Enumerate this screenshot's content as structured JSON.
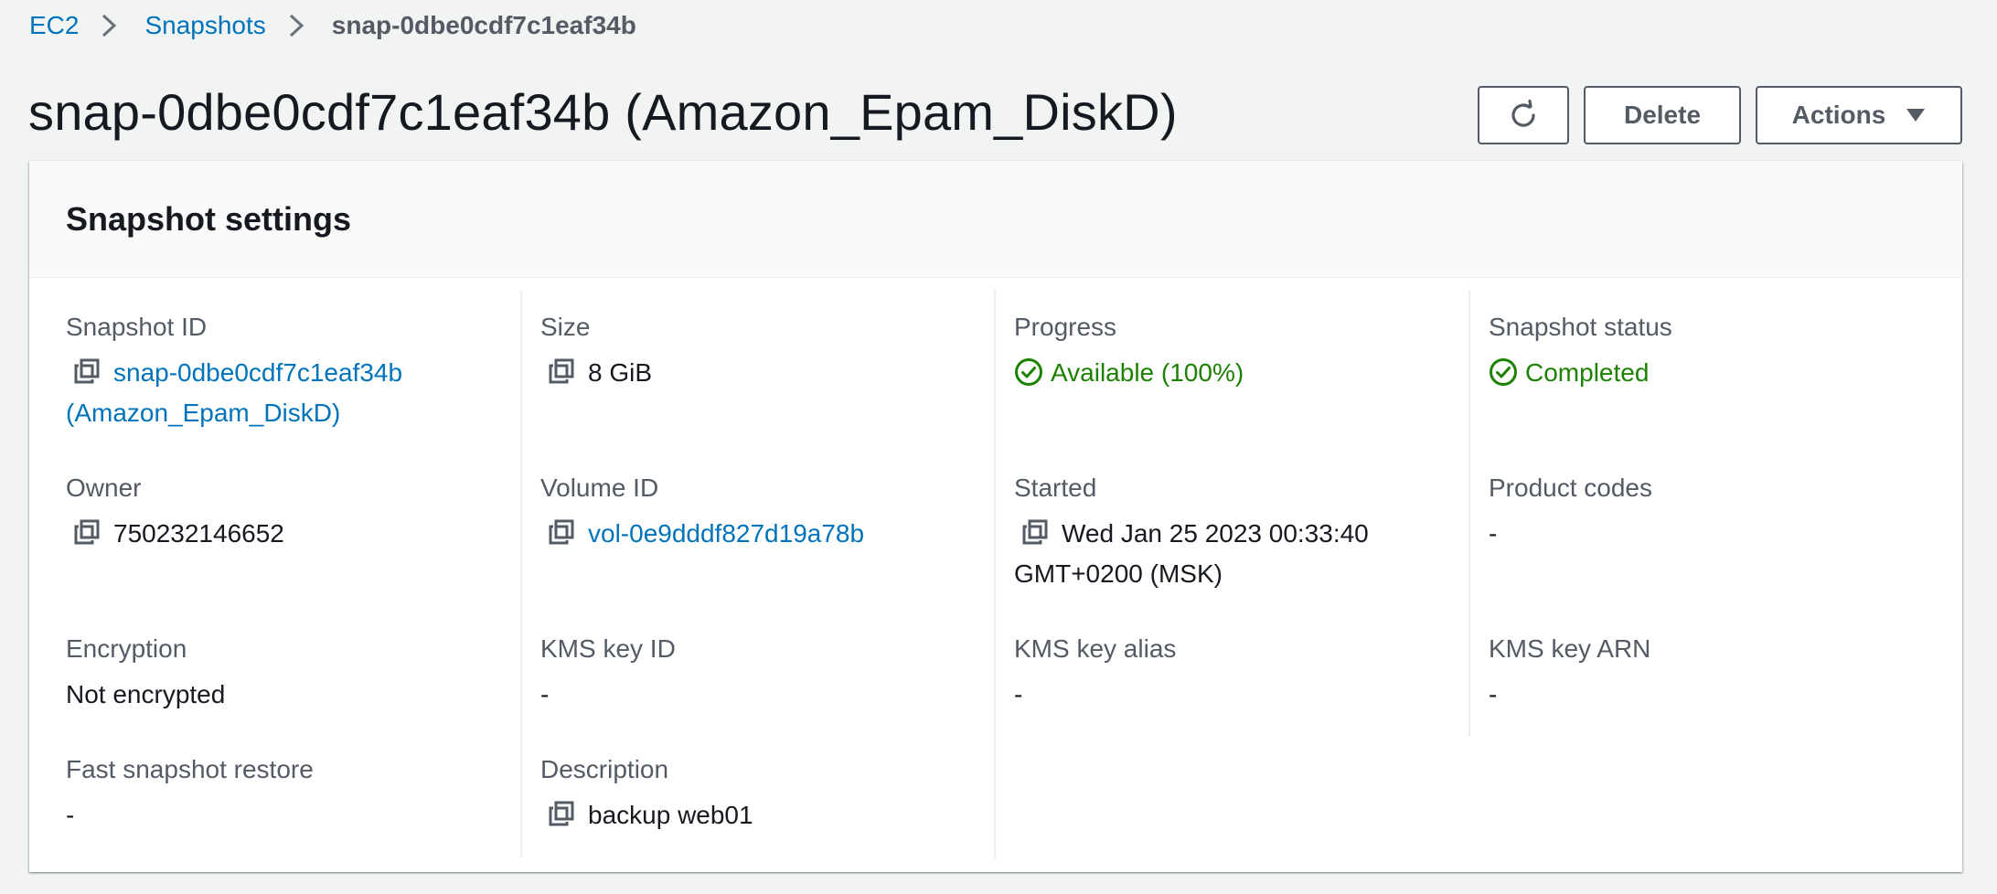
{
  "breadcrumb": {
    "ec2": "EC2",
    "snapshots": "Snapshots",
    "current": "snap-0dbe0cdf7c1eaf34b"
  },
  "page": {
    "title": "snap-0dbe0cdf7c1eaf34b (Amazon_Epam_DiskD)"
  },
  "toolbar": {
    "refresh_icon": "refresh-icon",
    "delete_label": "Delete",
    "actions_label": "Actions"
  },
  "panel": {
    "title": "Snapshot settings"
  },
  "fields": {
    "snapshot_id": {
      "label": "Snapshot ID",
      "value_line1": "snap-0dbe0cdf7c1eaf34b",
      "value_line2": "(Amazon_Epam_DiskD)"
    },
    "size": {
      "label": "Size",
      "value": "8 GiB"
    },
    "progress": {
      "label": "Progress",
      "value": "Available (100%)"
    },
    "snapshot_status": {
      "label": "Snapshot status",
      "value": "Completed"
    },
    "owner": {
      "label": "Owner",
      "value": "750232146652"
    },
    "volume_id": {
      "label": "Volume ID",
      "value": "vol-0e9dddf827d19a78b"
    },
    "started": {
      "label": "Started",
      "value_line1": "Wed Jan 25 2023 00:33:40",
      "value_line2": "GMT+0200 (MSK)"
    },
    "product_codes": {
      "label": "Product codes",
      "value": "-"
    },
    "encryption": {
      "label": "Encryption",
      "value": "Not encrypted"
    },
    "kms_key_id": {
      "label": "KMS key ID",
      "value": "-"
    },
    "kms_key_alias": {
      "label": "KMS key alias",
      "value": "-"
    },
    "kms_key_arn": {
      "label": "KMS key ARN",
      "value": "-"
    },
    "fast_snapshot_restore": {
      "label": "Fast snapshot restore",
      "value": "-"
    },
    "description": {
      "label": "Description",
      "value": "backup web01"
    }
  },
  "colors": {
    "link": "#0073bb",
    "success": "#1d8102",
    "text": "#16191f",
    "label": "#545b64",
    "background": "#f2f3f3"
  }
}
